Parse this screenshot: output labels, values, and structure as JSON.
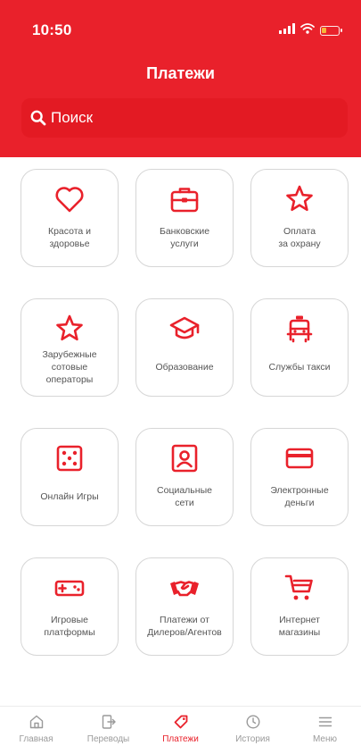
{
  "colors": {
    "brand": "#e9212b",
    "tile_border": "#d6d6d6",
    "label_gray": "#555555",
    "nav_inactive": "#9a9a9a"
  },
  "status_bar": {
    "time": "10:50",
    "battery_level": 0.3
  },
  "header": {
    "title": "Платежи"
  },
  "search": {
    "placeholder": "Поиск"
  },
  "categories": [
    {
      "label": "Красота и\nздоровье",
      "icon": "heart-icon"
    },
    {
      "label": "Банковские\nуслуги",
      "icon": "briefcase-icon"
    },
    {
      "label": "Оплата\nза охрану",
      "icon": "star-icon"
    },
    {
      "label": "Зарубежные\nсотовые\nоператоры",
      "icon": "star-icon"
    },
    {
      "label": "Образование",
      "icon": "graduation-cap-icon"
    },
    {
      "label": "Службы такси",
      "icon": "taxi-icon"
    },
    {
      "label": "Онлайн Игры",
      "icon": "dice-icon"
    },
    {
      "label": "Социальные\nсети",
      "icon": "user-card-icon"
    },
    {
      "label": "Электронные\nденьги",
      "icon": "credit-card-icon"
    },
    {
      "label": "Игровые\nплатформы",
      "icon": "gamepad-icon"
    },
    {
      "label": "Платежи от\nДилеров/Агентов",
      "icon": "handshake-icon"
    },
    {
      "label": "Интернет\nмагазины",
      "icon": "shopping-cart-icon"
    }
  ],
  "nav": [
    {
      "label": "Главная",
      "icon": "home-icon",
      "active": false
    },
    {
      "label": "Переводы",
      "icon": "transfer-icon",
      "active": false
    },
    {
      "label": "Платежи",
      "icon": "tag-icon",
      "active": true
    },
    {
      "label": "История",
      "icon": "clock-icon",
      "active": false
    },
    {
      "label": "Меню",
      "icon": "menu-icon",
      "active": false
    }
  ]
}
